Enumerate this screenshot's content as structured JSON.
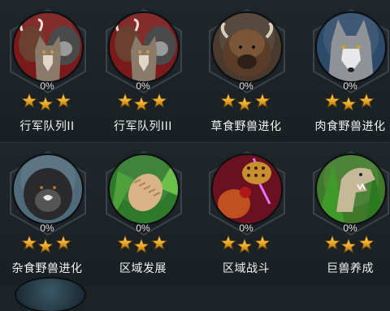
{
  "cards": [
    {
      "label": "行军队列II",
      "progress": "0%",
      "stars": 3,
      "icon": "wolf-bull-gorilla-icon",
      "bg": "#7a1a1a"
    },
    {
      "label": "行军队列III",
      "progress": "0%",
      "stars": 3,
      "icon": "wolf-bull-gorilla-icon",
      "bg": "#7a1a1a"
    },
    {
      "label": "草食野兽进化",
      "progress": "0%",
      "stars": 3,
      "icon": "bison-icon",
      "bg": "#4a3a2e"
    },
    {
      "label": "肉食野兽进化",
      "progress": "0%",
      "stars": 3,
      "icon": "wolf-icon",
      "bg": "#2e4a6a"
    },
    {
      "label": "杂食野兽进化",
      "progress": "0%",
      "stars": 3,
      "icon": "gorilla-icon",
      "bg": "#4f6a78"
    },
    {
      "label": "区域发展",
      "progress": "0%",
      "stars": 3,
      "icon": "pinecone-icon",
      "bg": "#2f7a2a"
    },
    {
      "label": "区域战斗",
      "progress": "0%",
      "stars": 3,
      "icon": "leopard-fight-icon",
      "bg": "#8a1a1a"
    },
    {
      "label": "巨兽养成",
      "progress": "0%",
      "stars": 3,
      "icon": "trex-icon",
      "bg": "#3f7a2a"
    }
  ],
  "colors": {
    "star": "#e8a928",
    "hex_border": "#3b4449",
    "text": "#f2f2f2"
  }
}
